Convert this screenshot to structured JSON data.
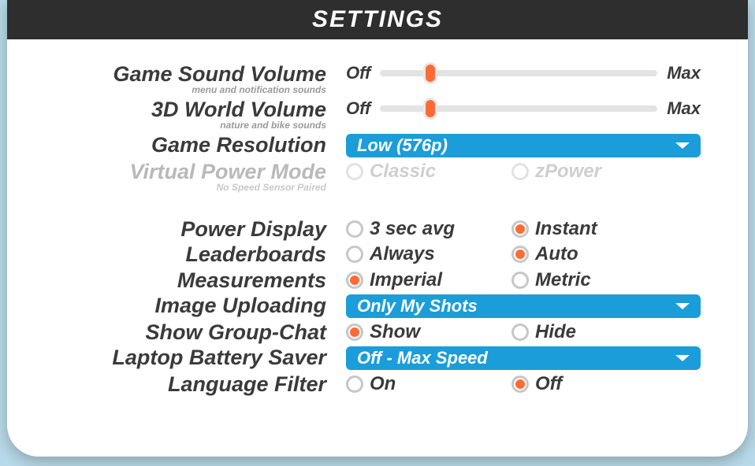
{
  "title": "SETTINGS",
  "slider_caps": {
    "min": "Off",
    "max": "Max"
  },
  "rows": {
    "game_sound": {
      "label": "Game Sound Volume",
      "sub": "menu and notification sounds",
      "value": 18
    },
    "world_volume": {
      "label": "3D World Volume",
      "sub": "nature and bike sounds",
      "value": 18
    },
    "game_res": {
      "label": "Game Resolution",
      "selected": "Low (576p)"
    },
    "vpm": {
      "label": "Virtual Power Mode",
      "sub": "No Speed Sensor Paired",
      "opts": [
        "Classic",
        "zPower"
      ],
      "selected": ""
    },
    "power_disp": {
      "label": "Power Display",
      "opts": [
        "3 sec avg",
        "Instant"
      ],
      "selected": "Instant"
    },
    "leaderboards": {
      "label": "Leaderboards",
      "opts": [
        "Always",
        "Auto"
      ],
      "selected": "Auto"
    },
    "measurements": {
      "label": "Measurements",
      "opts": [
        "Imperial",
        "Metric"
      ],
      "selected": "Imperial"
    },
    "image_upload": {
      "label": "Image Uploading",
      "selected": "Only My Shots"
    },
    "group_chat": {
      "label": "Show Group-Chat",
      "opts": [
        "Show",
        "Hide"
      ],
      "selected": "Show"
    },
    "battery": {
      "label": "Laptop Battery Saver",
      "selected": "Off - Max Speed"
    },
    "lang_filter": {
      "label": "Language Filter",
      "opts": [
        "On",
        "Off"
      ],
      "selected": "Off"
    }
  }
}
